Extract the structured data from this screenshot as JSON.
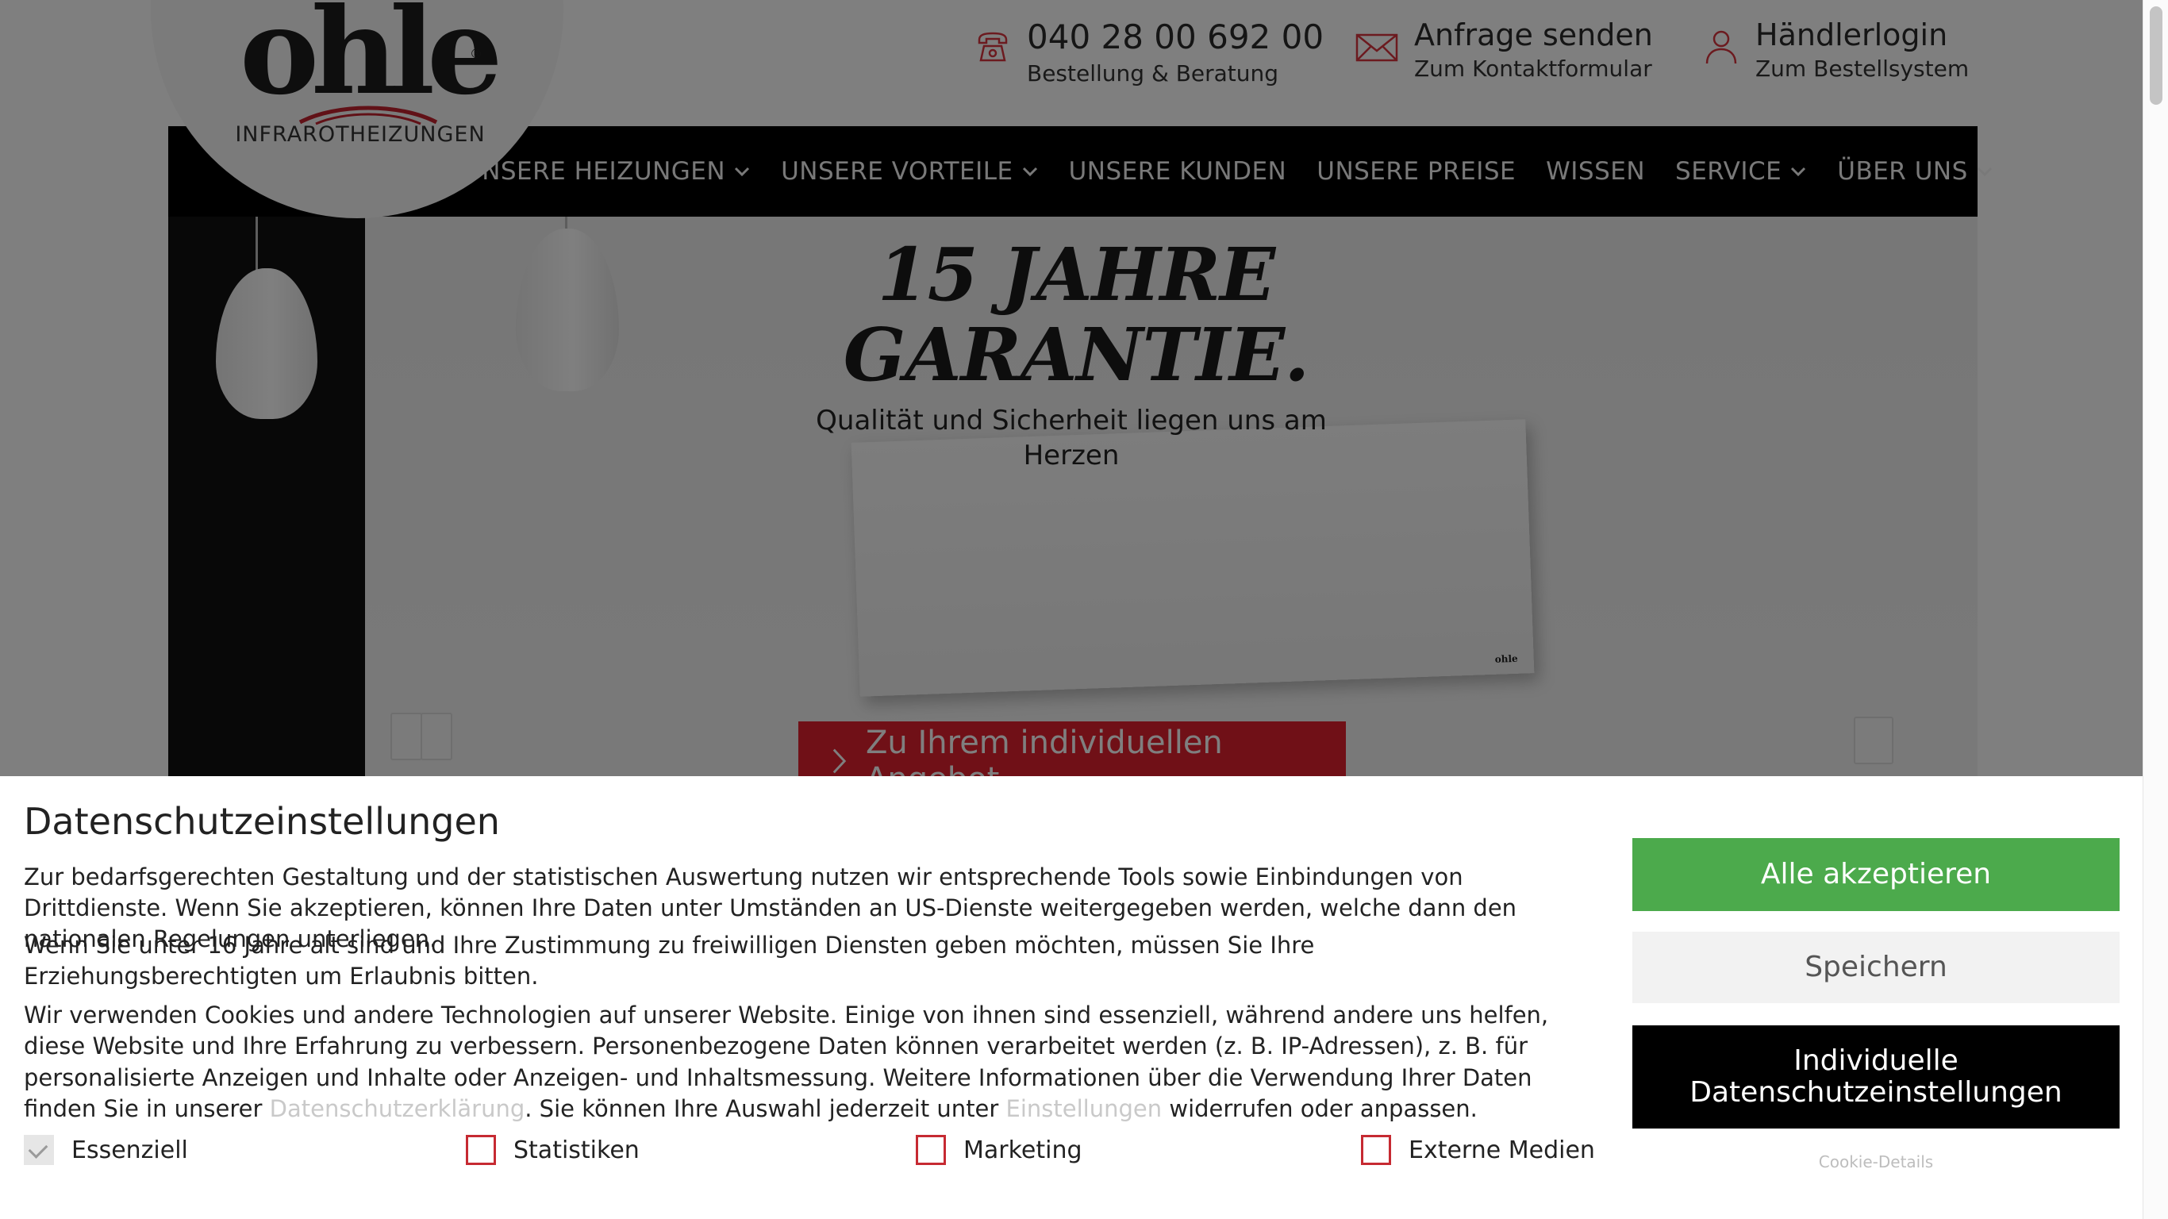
{
  "header": {
    "logo_text": "ohle",
    "logo_tagline": "INFRAROTHEIZUNGEN",
    "phone": {
      "number": "040 28 00 692 00",
      "caption": "Bestellung & Beratung"
    },
    "contact": {
      "title": "Anfrage senden",
      "caption": "Zum Kontaktformular"
    },
    "login": {
      "title": "Händlerlogin",
      "caption": "Zum Bestellsystem"
    }
  },
  "nav": {
    "items": [
      {
        "label": "UNSERE HEIZUNGEN",
        "dropdown": true
      },
      {
        "label": "UNSERE VORTEILE",
        "dropdown": true
      },
      {
        "label": "UNSERE KUNDEN",
        "dropdown": false
      },
      {
        "label": "UNSERE PREISE",
        "dropdown": false
      },
      {
        "label": "WISSEN",
        "dropdown": false
      },
      {
        "label": "SERVICE",
        "dropdown": true
      },
      {
        "label": "ÜBER UNS",
        "dropdown": true
      }
    ]
  },
  "hero": {
    "title_line1": "15 JAHRE",
    "title_line2": "GARANTIE.",
    "subtitle": "Qualität und Sicherheit liegen uns am Herzen",
    "cta_label": "Zu Ihrem individuellen Angebot"
  },
  "cookie": {
    "title": "Datenschutzeinstellungen",
    "p1": "Zur bedarfsgerechten Gestaltung und der statistischen Auswertung nutzen wir entsprechende Tools sowie Einbindungen von Drittdienste. Wenn Sie akzeptieren, können Ihre Daten unter Umständen an US-Dienste weitergegeben werden, welche dann den nationalen Regelungen unterliegen.",
    "p2": "Wenn Sie unter 16 Jahre alt sind und Ihre Zustimmung zu freiwilligen Diensten geben möchten, müssen Sie Ihre Erziehungsberechtigten um Erlaubnis bitten.",
    "p3_a": "Wir verwenden Cookies und andere Technologien auf unserer Website. Einige von ihnen sind essenziell, während andere uns helfen, diese Website und Ihre Erfahrung zu verbessern. Personenbezogene Daten können verarbeitet werden (z. B. IP-Adressen), z. B. für personalisierte Anzeigen und Inhalte oder Anzeigen- und Inhaltsmessung. Weitere Informationen über die Verwendung Ihrer Daten finden Sie in unserer ",
    "p3_link1": "Datenschutzerklärung",
    "p3_b": ". Sie können Ihre Auswahl jederzeit unter ",
    "p3_link2": "Einstellungen",
    "p3_c": " widerrufen oder anpassen.",
    "checkboxes": [
      {
        "label": "Essenziell",
        "checked": true
      },
      {
        "label": "Statistiken",
        "checked": false
      },
      {
        "label": "Marketing",
        "checked": false
      },
      {
        "label": "Externe Medien",
        "checked": false
      }
    ],
    "btn_accept": "Alle akzeptieren",
    "btn_save": "Speichern",
    "btn_individual": "Individuelle Datenschutzeinstellungen",
    "details_link": "Cookie-Details"
  },
  "colors": {
    "accent_red": "#e0202f",
    "accept_green": "#4caa4c",
    "nav_black": "#000000"
  },
  "icons": [
    "phone-icon",
    "mail-icon",
    "user-icon",
    "chevron-down-icon",
    "chevron-right-icon",
    "check-icon"
  ]
}
